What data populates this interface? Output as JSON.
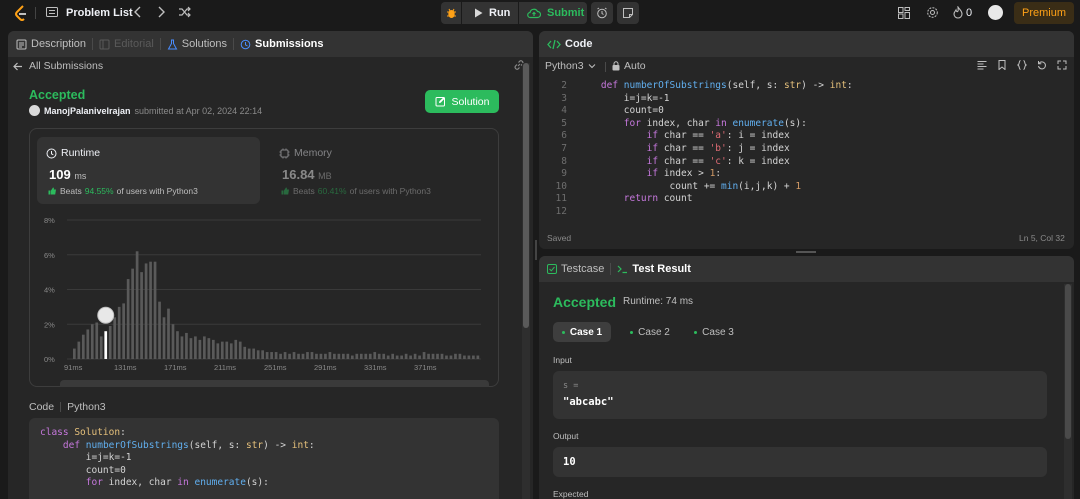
{
  "topbar": {
    "problem_list": "Problem List",
    "run": "Run",
    "submit": "Submit",
    "streak_count": "0",
    "premium": "Premium"
  },
  "left": {
    "tabs": [
      {
        "label": "Description"
      },
      {
        "label": "Editorial"
      },
      {
        "label": "Solutions"
      },
      {
        "label": "Submissions"
      }
    ],
    "back_label": "All Submissions",
    "status": "Accepted",
    "username": "ManojPalanivelrajan",
    "submitted_text": "submitted at Apr 02, 2024 22:14",
    "solution_button": "Solution",
    "runtime": {
      "label": "Runtime",
      "value": "109",
      "unit": "ms",
      "beats_prefix": "Beats",
      "beats_pct": "94.55%",
      "beats_suffix": "of users with Python3"
    },
    "memory": {
      "label": "Memory",
      "value": "16.84",
      "unit": "MB",
      "beats_prefix": "Beats",
      "beats_pct": "60.41%",
      "beats_suffix": "of users with Python3"
    },
    "code_label": "Code",
    "code_lang": "Python3"
  },
  "chart_data": {
    "type": "bar",
    "ylim": [
      0,
      8
    ],
    "yticks": [
      "8%",
      "6%",
      "4%",
      "2%",
      "0%"
    ],
    "xticks": [
      "91ms",
      "131ms",
      "171ms",
      "211ms",
      "251ms",
      "291ms",
      "331ms",
      "371ms"
    ],
    "highlight_index": 7,
    "values": [
      0.6,
      1.0,
      1.4,
      1.7,
      2.0,
      2.1,
      1.3,
      1.6,
      1.9,
      2.4,
      3.0,
      3.2,
      4.6,
      5.2,
      6.2,
      5.0,
      5.5,
      5.6,
      5.6,
      3.3,
      2.4,
      2.9,
      2.0,
      1.6,
      1.3,
      1.5,
      1.2,
      1.3,
      1.1,
      1.3,
      1.2,
      1.1,
      0.9,
      1.0,
      1.0,
      0.9,
      1.1,
      1.0,
      0.7,
      0.6,
      0.6,
      0.5,
      0.5,
      0.4,
      0.4,
      0.4,
      0.3,
      0.4,
      0.3,
      0.4,
      0.3,
      0.3,
      0.4,
      0.4,
      0.3,
      0.3,
      0.3,
      0.4,
      0.3,
      0.3,
      0.3,
      0.3,
      0.2,
      0.3,
      0.3,
      0.3,
      0.3,
      0.4,
      0.3,
      0.3,
      0.2,
      0.3,
      0.2,
      0.2,
      0.3,
      0.2,
      0.3,
      0.2,
      0.4,
      0.3,
      0.3,
      0.3,
      0.3,
      0.2,
      0.2,
      0.3,
      0.3,
      0.2,
      0.2,
      0.2,
      0.2
    ]
  },
  "left_code": [
    [
      [
        "kw",
        "class "
      ],
      [
        "cl",
        "Solution"
      ],
      [
        "op",
        ":"
      ]
    ],
    [
      [
        "op",
        "    "
      ],
      [
        "kw",
        "def "
      ],
      [
        "fn",
        "numberOfSubstrings"
      ],
      [
        "op",
        "("
      ],
      [
        "id",
        "self"
      ],
      [
        "op",
        ", s: "
      ],
      [
        "cl",
        "str"
      ],
      [
        "op",
        ") -> "
      ],
      [
        "cl",
        "int"
      ],
      [
        "op",
        ":"
      ]
    ],
    [
      [
        "op",
        "        "
      ],
      [
        "id",
        "i=j=k=-1"
      ]
    ],
    [
      [
        "op",
        "        "
      ],
      [
        "id",
        "count=0"
      ]
    ],
    [
      [
        "op",
        "        "
      ],
      [
        "kw",
        "for "
      ],
      [
        "id",
        "index, char "
      ],
      [
        "kw",
        "in "
      ],
      [
        "fn",
        "enumerate"
      ],
      [
        "op",
        "(s):"
      ]
    ]
  ],
  "editor": {
    "title": "Code",
    "language": "Python3",
    "auto": "Auto",
    "saved": "Saved",
    "cursor": "Ln 5, Col 32",
    "line_numbers": [
      "2",
      "3",
      "4",
      "5",
      "6",
      "7",
      "8",
      "9",
      "10",
      "11",
      "12"
    ],
    "lines": [
      [
        [
          "op",
          "    "
        ],
        [
          "kw",
          "def "
        ],
        [
          "fn",
          "numberOfSubstrings"
        ],
        [
          "op",
          "("
        ],
        [
          "id",
          "self"
        ],
        [
          "op",
          ", s: "
        ],
        [
          "cl",
          "str"
        ],
        [
          "op",
          ") -> "
        ],
        [
          "cl",
          "int"
        ],
        [
          "op",
          ":"
        ]
      ],
      [
        [
          "op",
          "        "
        ],
        [
          "id",
          "i=j=k=-1"
        ]
      ],
      [
        [
          "op",
          "        "
        ],
        [
          "id",
          "count=0"
        ]
      ],
      [
        [
          "op",
          "        "
        ],
        [
          "kw",
          "for "
        ],
        [
          "id",
          "index, char "
        ],
        [
          "kw",
          "in "
        ],
        [
          "fn",
          "enumerate"
        ],
        [
          "op",
          "(s):"
        ]
      ],
      [
        [
          "op",
          "            "
        ],
        [
          "kw",
          "if "
        ],
        [
          "id",
          "char == "
        ],
        [
          "st",
          "'a'"
        ],
        [
          "op",
          ": i = index"
        ]
      ],
      [
        [
          "op",
          "            "
        ],
        [
          "kw",
          "if "
        ],
        [
          "id",
          "char == "
        ],
        [
          "st",
          "'b'"
        ],
        [
          "op",
          ": j = index"
        ]
      ],
      [
        [
          "op",
          "            "
        ],
        [
          "kw",
          "if "
        ],
        [
          "id",
          "char == "
        ],
        [
          "st",
          "'c'"
        ],
        [
          "op",
          ": k = index"
        ]
      ],
      [
        [
          "op",
          "            "
        ],
        [
          "kw",
          "if "
        ],
        [
          "id",
          "index > "
        ],
        [
          "nm",
          "1"
        ],
        [
          "op",
          ":"
        ]
      ],
      [
        [
          "op",
          "                "
        ],
        [
          "id",
          "count += "
        ],
        [
          "fn",
          "min"
        ],
        [
          "op",
          "(i,j,k) + "
        ],
        [
          "nm",
          "1"
        ]
      ],
      [
        [
          "op",
          "        "
        ],
        [
          "kw",
          "return "
        ],
        [
          "id",
          "count"
        ]
      ],
      [
        [
          "op",
          ""
        ]
      ]
    ]
  },
  "results": {
    "testcase_tab": "Testcase",
    "result_tab": "Test Result",
    "status": "Accepted",
    "runtime": "Runtime: 74 ms",
    "cases": [
      "Case 1",
      "Case 2",
      "Case 3"
    ],
    "input_label": "Input",
    "input_var": "s =",
    "input_value": "\"abcabc\"",
    "output_label": "Output",
    "output_value": "10",
    "expected_label": "Expected"
  }
}
